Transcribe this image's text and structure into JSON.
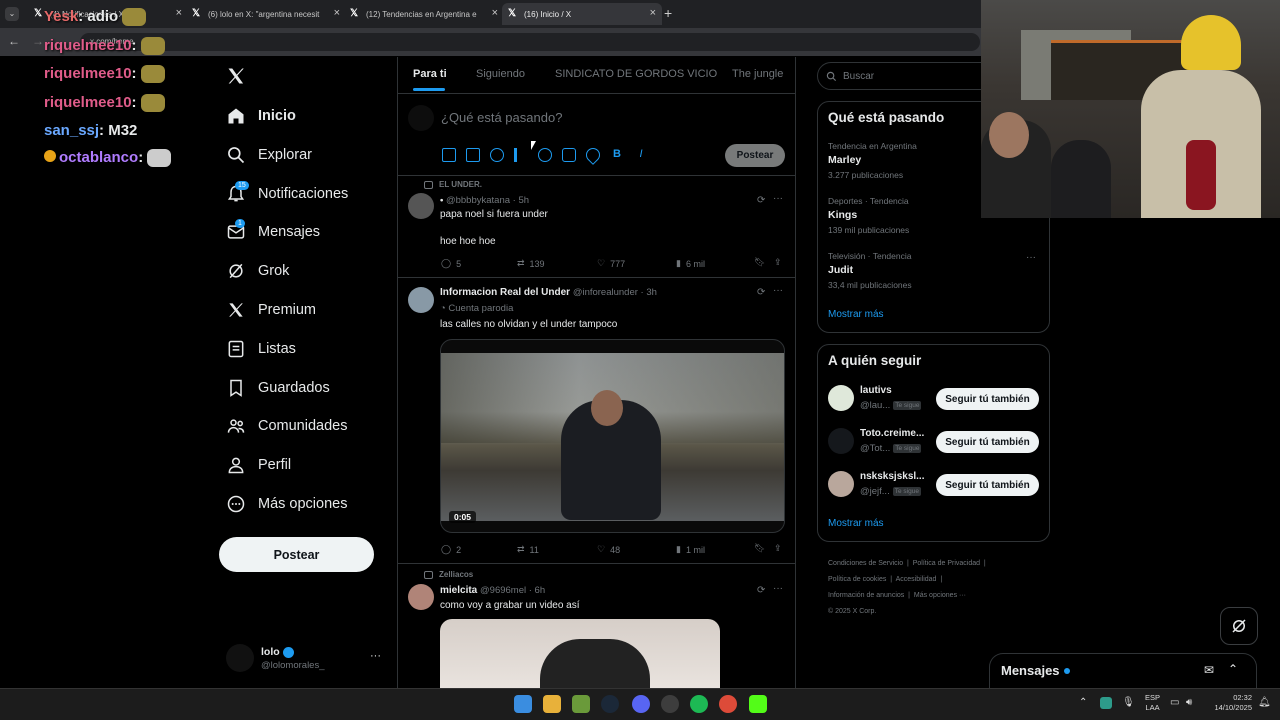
{
  "browser": {
    "tabs": [
      {
        "label": "(4) Notificaciones / X"
      },
      {
        "label": "(6) lolo en X: \"argentina necesit"
      },
      {
        "label": "(12) Tendencias en Argentina e"
      },
      {
        "label": "(16) Inicio / X"
      }
    ],
    "address": "x.com/home"
  },
  "chat": [
    {
      "user": "Yesk",
      "text": ": adio",
      "color": "#e66a6a"
    },
    {
      "user": "riquelmee10",
      "text": ":",
      "color": "#e05c8a"
    },
    {
      "user": "riquelmee10",
      "text": ":",
      "color": "#e05c8a"
    },
    {
      "user": "riquelmee10",
      "text": ":",
      "color": "#e05c8a"
    },
    {
      "user": "san_ssj",
      "text": ": M32",
      "color": "#6aa8ff"
    },
    {
      "user": "octablanco",
      "text": ":",
      "color": "#b07cff"
    }
  ],
  "nav": {
    "items": [
      {
        "label": "Inicio",
        "icon": "home-icon"
      },
      {
        "label": "Explorar",
        "icon": "search-icon"
      },
      {
        "label": "Notificaciones",
        "icon": "bell-icon",
        "badge": "15"
      },
      {
        "label": "Mensajes",
        "icon": "mail-icon",
        "badge": "1"
      },
      {
        "label": "Grok",
        "icon": "grok-icon"
      },
      {
        "label": "Premium",
        "icon": "x-logo-icon"
      },
      {
        "label": "Listas",
        "icon": "list-icon"
      },
      {
        "label": "Guardados",
        "icon": "bookmark-icon"
      },
      {
        "label": "Comunidades",
        "icon": "people-icon"
      },
      {
        "label": "Perfil",
        "icon": "person-icon"
      },
      {
        "label": "Más opciones",
        "icon": "more-circle-icon"
      }
    ],
    "post_button": "Postear",
    "account": {
      "name": "lolo",
      "handle": "@lolomorales_"
    }
  },
  "feed_tabs": [
    "Para ti",
    "Siguiendo",
    "SINDICATO DE GORDOS VICIO",
    "The jungle"
  ],
  "composer": {
    "placeholder": "¿Qué está pasando?",
    "post_label": "Postear"
  },
  "tweets": [
    {
      "community": "EL UNDER.",
      "handle": "@bbbbykatana · 5h",
      "text1": "papa noel si fuera under",
      "text2": "hoe hoe hoe",
      "replies": "5",
      "reposts": "139",
      "likes": "777",
      "views": "6 mil"
    },
    {
      "name": "Informacion Real del Under",
      "handle": "@inforealunder · 3h",
      "label": "Cuenta parodia",
      "text1": "las calles no olvidan y el under tampoco",
      "video_time": "0:05",
      "replies": "2",
      "reposts": "11",
      "likes": "48",
      "views": "1 mil"
    },
    {
      "community": "Zelliacos",
      "name": "mielcita",
      "handle": "@9696mel · 6h",
      "text1": "como voy a grabar un video así"
    }
  ],
  "search_placeholder": "Buscar",
  "trends": {
    "title": "Qué está pasando",
    "items": [
      {
        "context": "Tendencia en Argentina",
        "name": "Marley",
        "count": "3.277 publicaciones"
      },
      {
        "context": "Deportes · Tendencia",
        "name": "Kings",
        "count": "139 mil publicaciones"
      },
      {
        "context": "Televisión · Tendencia",
        "name": "Judit",
        "count": "33,4 mil publicaciones"
      }
    ],
    "more": "Mostrar más"
  },
  "who_to_follow": {
    "title": "A quién seguir",
    "items": [
      {
        "name": "lautivs",
        "handle": "@lau...",
        "tag": "Te sigue",
        "button": "Seguir tú también"
      },
      {
        "name": "Toto.creime...",
        "handle": "@Tot...",
        "tag": "Te sigue",
        "button": "Seguir tú también"
      },
      {
        "name": "nsksksjsksl...",
        "handle": "@jejf...",
        "tag": "Te sigue",
        "button": "Seguir tú también"
      }
    ],
    "more": "Mostrar más"
  },
  "footer": {
    "l1a": "Condiciones de Servicio",
    "l1b": "Política de Privacidad",
    "l2a": "Política de cookies",
    "l2b": "Accesibilidad",
    "l3a": "Información de anuncios",
    "l3b": "Más opciones ···",
    "copy": "© 2025 X Corp."
  },
  "messages_drawer": "Mensajes",
  "system": {
    "lang1": "ESP",
    "lang2": "LAA",
    "time": "02:32",
    "date": "14/10/2025"
  },
  "colors": {
    "accent": "#1d9bf0",
    "bg": "#000000",
    "border": "#2f3336"
  }
}
